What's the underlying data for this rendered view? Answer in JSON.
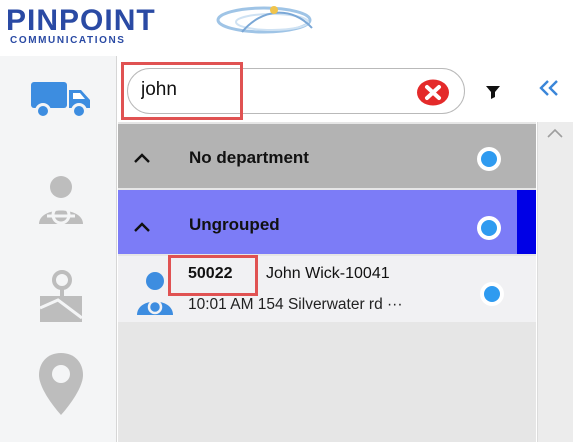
{
  "brand": {
    "name": "PINPOINT",
    "tagline": "COMMUNICATIONS",
    "color": "#2a4aa4"
  },
  "sidebar": {
    "items": [
      {
        "icon": "truck-icon",
        "active": true,
        "color": "#3d8de0"
      },
      {
        "icon": "driver-icon",
        "active": false,
        "color": "#bdbdbd"
      },
      {
        "icon": "map-route-icon",
        "active": false,
        "color": "#bdbdbd"
      },
      {
        "icon": "location-pin-icon",
        "active": false,
        "color": "#bdbdbd"
      }
    ]
  },
  "search": {
    "value": "john",
    "clear_icon": "clear-x-icon",
    "filter_icon": "filter-icon",
    "collapse_icon": "double-chevron-left-icon"
  },
  "groups": [
    {
      "label": "No department",
      "expanded": true,
      "color": "#b3b3b3"
    },
    {
      "label": "Ungrouped",
      "expanded": true,
      "color": "#7c7cf7",
      "accent": "#0000e6"
    }
  ],
  "vehicles": [
    {
      "id": "50022",
      "name": "John Wick-10041",
      "status": "10:01 AM 154 Silverwater rd ···",
      "icon": "driver-avatar-icon"
    }
  ],
  "colors": {
    "radio": "#2f9bf0",
    "highlight": "#e05252"
  }
}
